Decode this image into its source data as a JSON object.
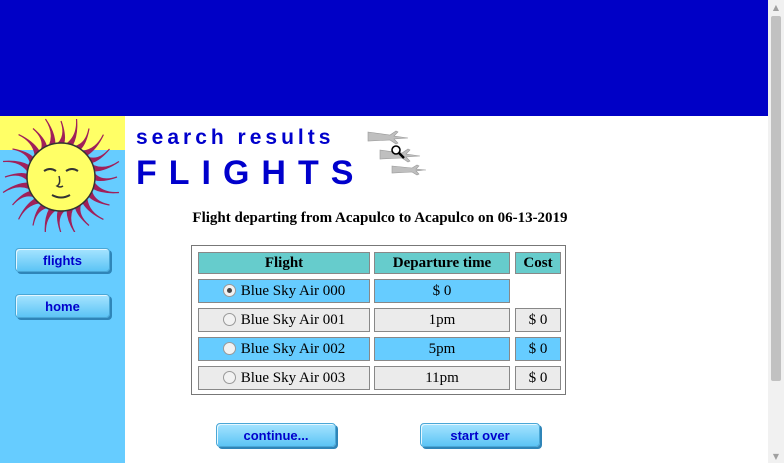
{
  "colors": {
    "banner": "#0000c6",
    "sidebar": "#66ccff",
    "header_cell": "#66cccc",
    "highlight_cell": "#66ccff",
    "title_text": "#0000cc"
  },
  "header": {
    "subtitle": "search results",
    "title": "FLIGHTS"
  },
  "sidebar": {
    "items": [
      {
        "label": "flights"
      },
      {
        "label": "home"
      }
    ]
  },
  "caption": "Flight departing from Acapulco to Acapulco on 06-13-2019",
  "table": {
    "columns": [
      "Flight",
      "Departure time",
      "Cost"
    ],
    "rows": [
      {
        "flight": "Blue Sky Air 000",
        "time": "$ 0",
        "cost": "",
        "selected": true
      },
      {
        "flight": "Blue Sky Air 001",
        "time": "1pm",
        "cost": "$ 0",
        "selected": false
      },
      {
        "flight": "Blue Sky Air 002",
        "time": "5pm",
        "cost": "$ 0",
        "selected": false
      },
      {
        "flight": "Blue Sky Air 003",
        "time": "11pm",
        "cost": "$ 0",
        "selected": false
      }
    ]
  },
  "buttons": {
    "continue": "continue...",
    "start_over": "start over"
  },
  "icons": {
    "logo": "sun-logo-icon",
    "planes": "airplanes-icon",
    "cursor": "magnifier-cursor-icon"
  }
}
